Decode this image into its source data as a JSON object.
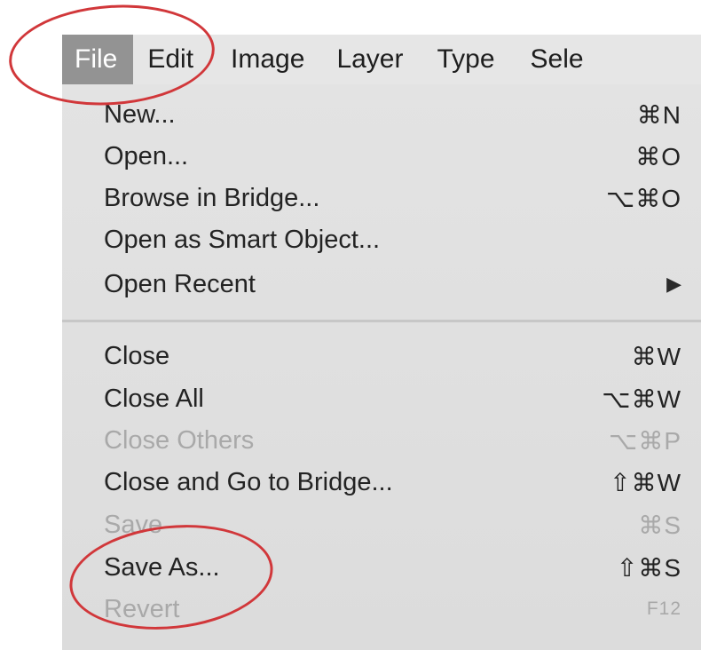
{
  "menubar": {
    "items": [
      {
        "label": "File",
        "active": true
      },
      {
        "label": "Edit"
      },
      {
        "label": "Image"
      },
      {
        "label": "Layer"
      },
      {
        "label": "Type"
      },
      {
        "label": "Sele"
      }
    ]
  },
  "file_menu": {
    "items": [
      {
        "label": "New...",
        "shortcut": "⌘N",
        "enabled": true
      },
      {
        "label": "Open...",
        "shortcut": "⌘O",
        "enabled": true
      },
      {
        "label": "Browse in Bridge...",
        "shortcut": "⌥⌘O",
        "enabled": true
      },
      {
        "label": "Open as Smart Object...",
        "shortcut": "",
        "enabled": true
      },
      {
        "label": "Open Recent",
        "submenu_arrow": "▶",
        "enabled": true
      },
      {
        "label": "Close",
        "shortcut": "⌘W",
        "enabled": true
      },
      {
        "label": "Close All",
        "shortcut": "⌥⌘W",
        "enabled": true
      },
      {
        "label": "Close Others",
        "shortcut": "⌥⌘P",
        "enabled": false
      },
      {
        "label": "Close and Go to Bridge...",
        "shortcut": "⇧⌘W",
        "enabled": true
      },
      {
        "label": "Save",
        "shortcut": "⌘S",
        "enabled": false
      },
      {
        "label": "Save As...",
        "shortcut": "⇧⌘S",
        "enabled": true
      },
      {
        "label": "Revert",
        "shortcut": "F12",
        "enabled": false
      }
    ]
  },
  "annotations": {
    "color": "#d1373a",
    "highlighted": [
      "File",
      "Save As..."
    ]
  },
  "colors": {
    "menu_background": "#e3e3e3",
    "active_highlight": "#939393",
    "disabled_text": "#a9a9a9"
  }
}
